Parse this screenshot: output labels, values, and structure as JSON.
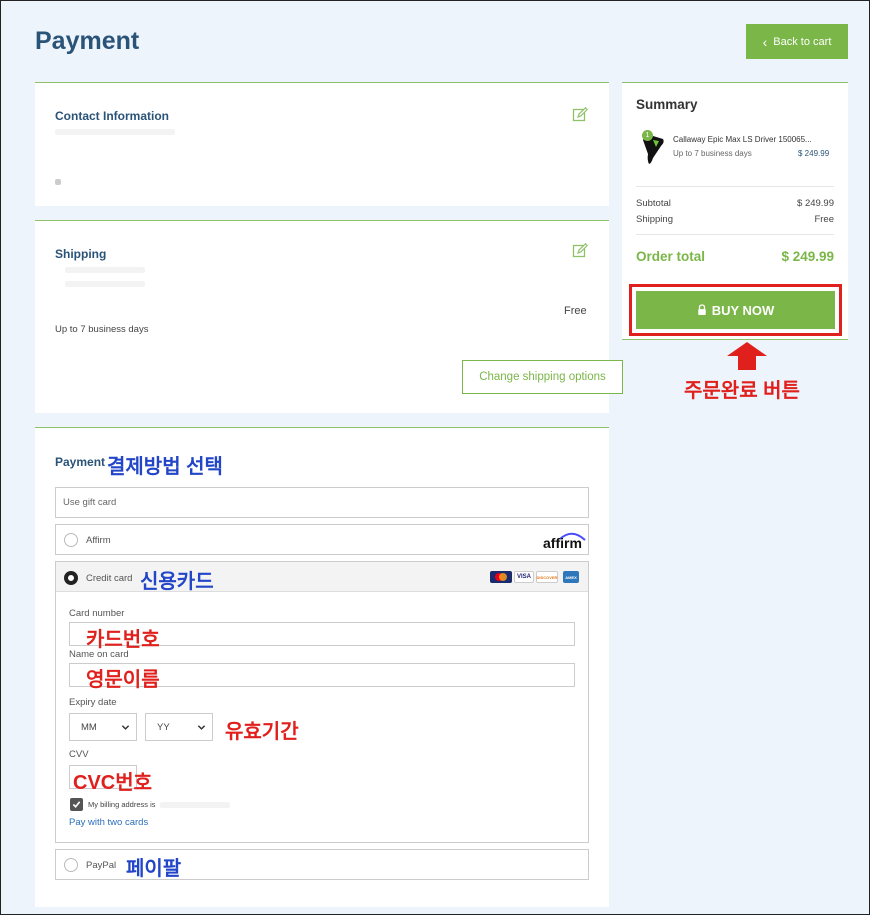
{
  "header": {
    "title": "Payment",
    "back_label": "Back to cart"
  },
  "contact": {
    "title": "Contact Information"
  },
  "shipping": {
    "title": "Shipping",
    "price": "Free",
    "eta": "Up to 7 business days",
    "change_label": "Change shipping options"
  },
  "payment": {
    "title": "Payment",
    "annot_title": "결제방법 선택",
    "gift_placeholder": "Use gift card",
    "affirm_label": "Affirm",
    "affirm_logo": "affirm",
    "credit_label": "Credit card",
    "annot_credit": "신용카드",
    "card_logos": [
      "MC",
      "VISA",
      "DISCOVER",
      "AMEX"
    ],
    "card_number_label": "Card number",
    "annot_card_number": "카드번호",
    "name_label": "Name on card",
    "annot_name": "영문이름",
    "expiry_label": "Expiry date",
    "month_value": "MM",
    "year_value": "YY",
    "annot_expiry": "유효기간",
    "cvv_label": "CVV",
    "annot_cvv": "CVC번호",
    "billing_label": "My billing address is",
    "two_cards_link": "Pay with two cards",
    "paypal_label": "PayPal",
    "annot_paypal": "페이팔"
  },
  "summary": {
    "title": "Summary",
    "item_name": "Callaway Epic Max LS Driver 150065...",
    "item_eta": "Up to 7 business days",
    "item_price": "$ 249.99",
    "item_qty": "1",
    "subtotal_label": "Subtotal",
    "subtotal_value": "$ 249.99",
    "shipping_label": "Shipping",
    "shipping_value": "Free",
    "total_label": "Order total",
    "total_value": "$ 249.99",
    "buy_label": "BUY NOW",
    "annot_buy": "주문완료 버튼"
  },
  "colors": {
    "accent_green": "#7ab648",
    "title_blue": "#2a5378",
    "annotation_red": "#e0201c",
    "annotation_blue": "#2346c8"
  }
}
